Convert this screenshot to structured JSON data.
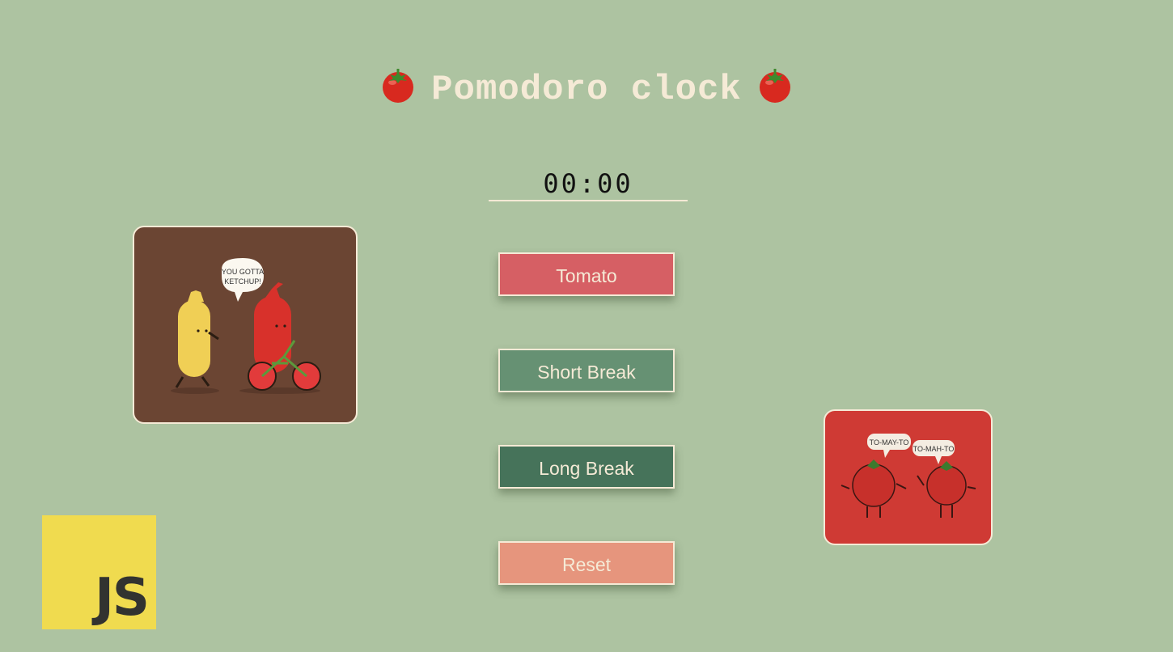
{
  "header": {
    "title": "Pomodoro clock",
    "left_icon": "tomato-icon",
    "right_icon": "tomato-icon"
  },
  "timer": {
    "display": "00:00"
  },
  "buttons": {
    "tomato_label": "Tomato",
    "short_break_label": "Short Break",
    "long_break_label": "Long Break",
    "reset_label": "Reset"
  },
  "images": {
    "left_speech_bubble": "YOU GOTTA KETCHUP!",
    "right_bubble_left": "TO-MAY-TO",
    "right_bubble_right": "TO-MAH-TO"
  },
  "logo": {
    "text": "JS"
  },
  "colors": {
    "background": "#adc3a1",
    "cream": "#f5ead6",
    "tomato_button": "#d65f64",
    "short_break_button": "#669173",
    "long_break_button": "#46735a",
    "reset_button": "#e6957d",
    "js_yellow": "#f0db4f"
  }
}
